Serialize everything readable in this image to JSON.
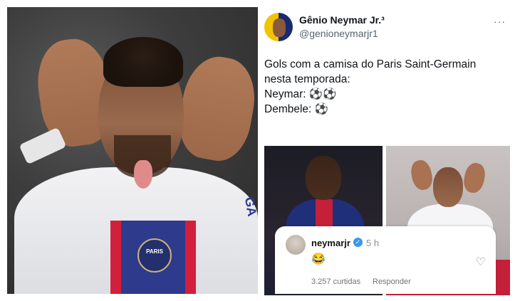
{
  "tweet": {
    "display_name": "Gênio Neymar Jr.³",
    "handle": "@genioneymarjr1",
    "more": "···",
    "lines": [
      "Gols com a camisa do Paris Saint-Germain",
      "nesta temporada:",
      "",
      "Neymar: ⚽⚽",
      "Dembele: ⚽"
    ]
  },
  "left_photo": {
    "crest_text": "PARIS",
    "sleeve_text": "GA"
  },
  "comment": {
    "username": "neymarjr",
    "verified_mark": "✓",
    "time": "5 h",
    "emoji": "😂",
    "likes": "3.257 curtidas",
    "reply": "Responder",
    "heart_icon": "♡"
  },
  "colors": {
    "psg_blue": "#2e3a8c",
    "psg_red": "#d21f3c",
    "verified": "#3897f0"
  }
}
